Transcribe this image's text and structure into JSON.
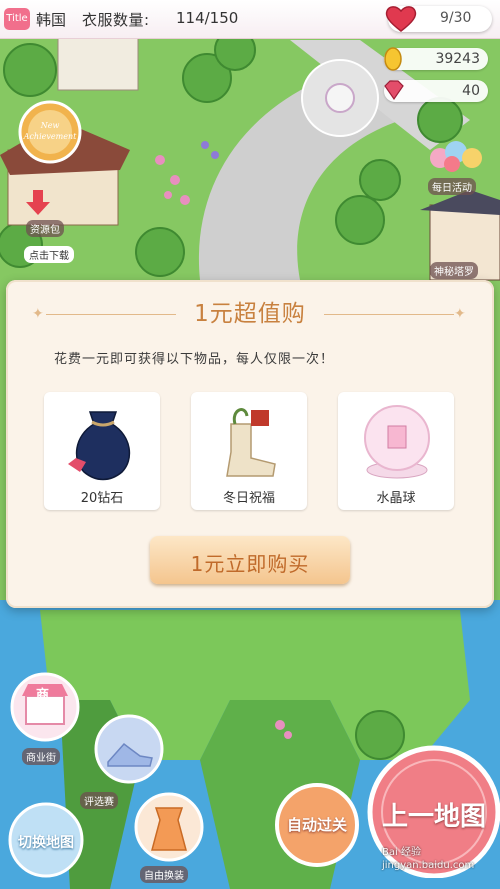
{
  "topbar": {
    "title_badge": "Title",
    "country": "韩国",
    "clothes_label": "衣服数量:",
    "clothes_value": "114/150",
    "hearts_value": "9/30"
  },
  "resources": {
    "coins": "39243",
    "gems": "40"
  },
  "map_icons": {
    "resource_pack_label": "资源包",
    "download_label": "点击下载",
    "daily_label": "每日活动",
    "tarot_label": "神秘塔罗",
    "new_badge": "New Achievement"
  },
  "modal": {
    "title": "1元超值购",
    "description": "花费一元即可获得以下物品，每人仅限一次！",
    "items": [
      {
        "label": "20钻石",
        "icon": "diamond-bag-icon"
      },
      {
        "label": "冬日祝福",
        "icon": "winter-boot-icon"
      },
      {
        "label": "水晶球",
        "icon": "crystal-ball-icon"
      }
    ],
    "buy_label": "1元立即购买"
  },
  "menu": {
    "shop_badge": "商",
    "shop_label": "商业街",
    "contest_label": "评选赛",
    "switch_map_label": "切换地图",
    "free_dress_label": "自由换装",
    "auto_pass_label": "自动过关",
    "prev_map_label": "上一地图"
  },
  "watermark": "Bai 经验 jingyan.baidu.com",
  "colors": {
    "accent_pink": "#f16f8c",
    "modal_bg": "#fbf3e9",
    "title_gold": "#c8813f",
    "grass": "#7fc35a",
    "water": "#4aa8dd"
  }
}
